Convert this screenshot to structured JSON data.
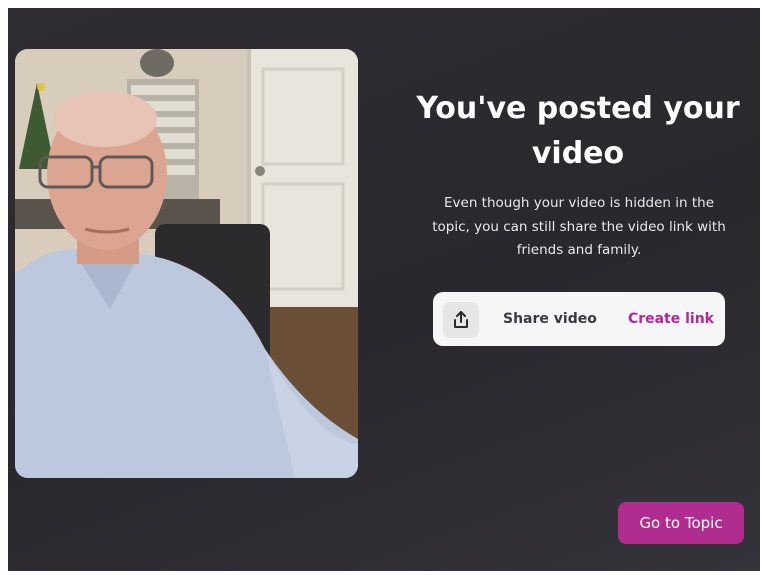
{
  "posted": {
    "title": "You've posted your video",
    "description": "Even though your video is hidden in the topic, you can still share the video link with friends and family."
  },
  "share": {
    "icon": "share-upload-icon",
    "label": "Share video",
    "action_label": "Create link"
  },
  "actions": {
    "go_to_topic_label": "Go to Topic"
  },
  "colors": {
    "background": "#2c2a2f",
    "accent": "#b12c8f",
    "link": "#b8259a",
    "card": "#f6f6f7"
  }
}
